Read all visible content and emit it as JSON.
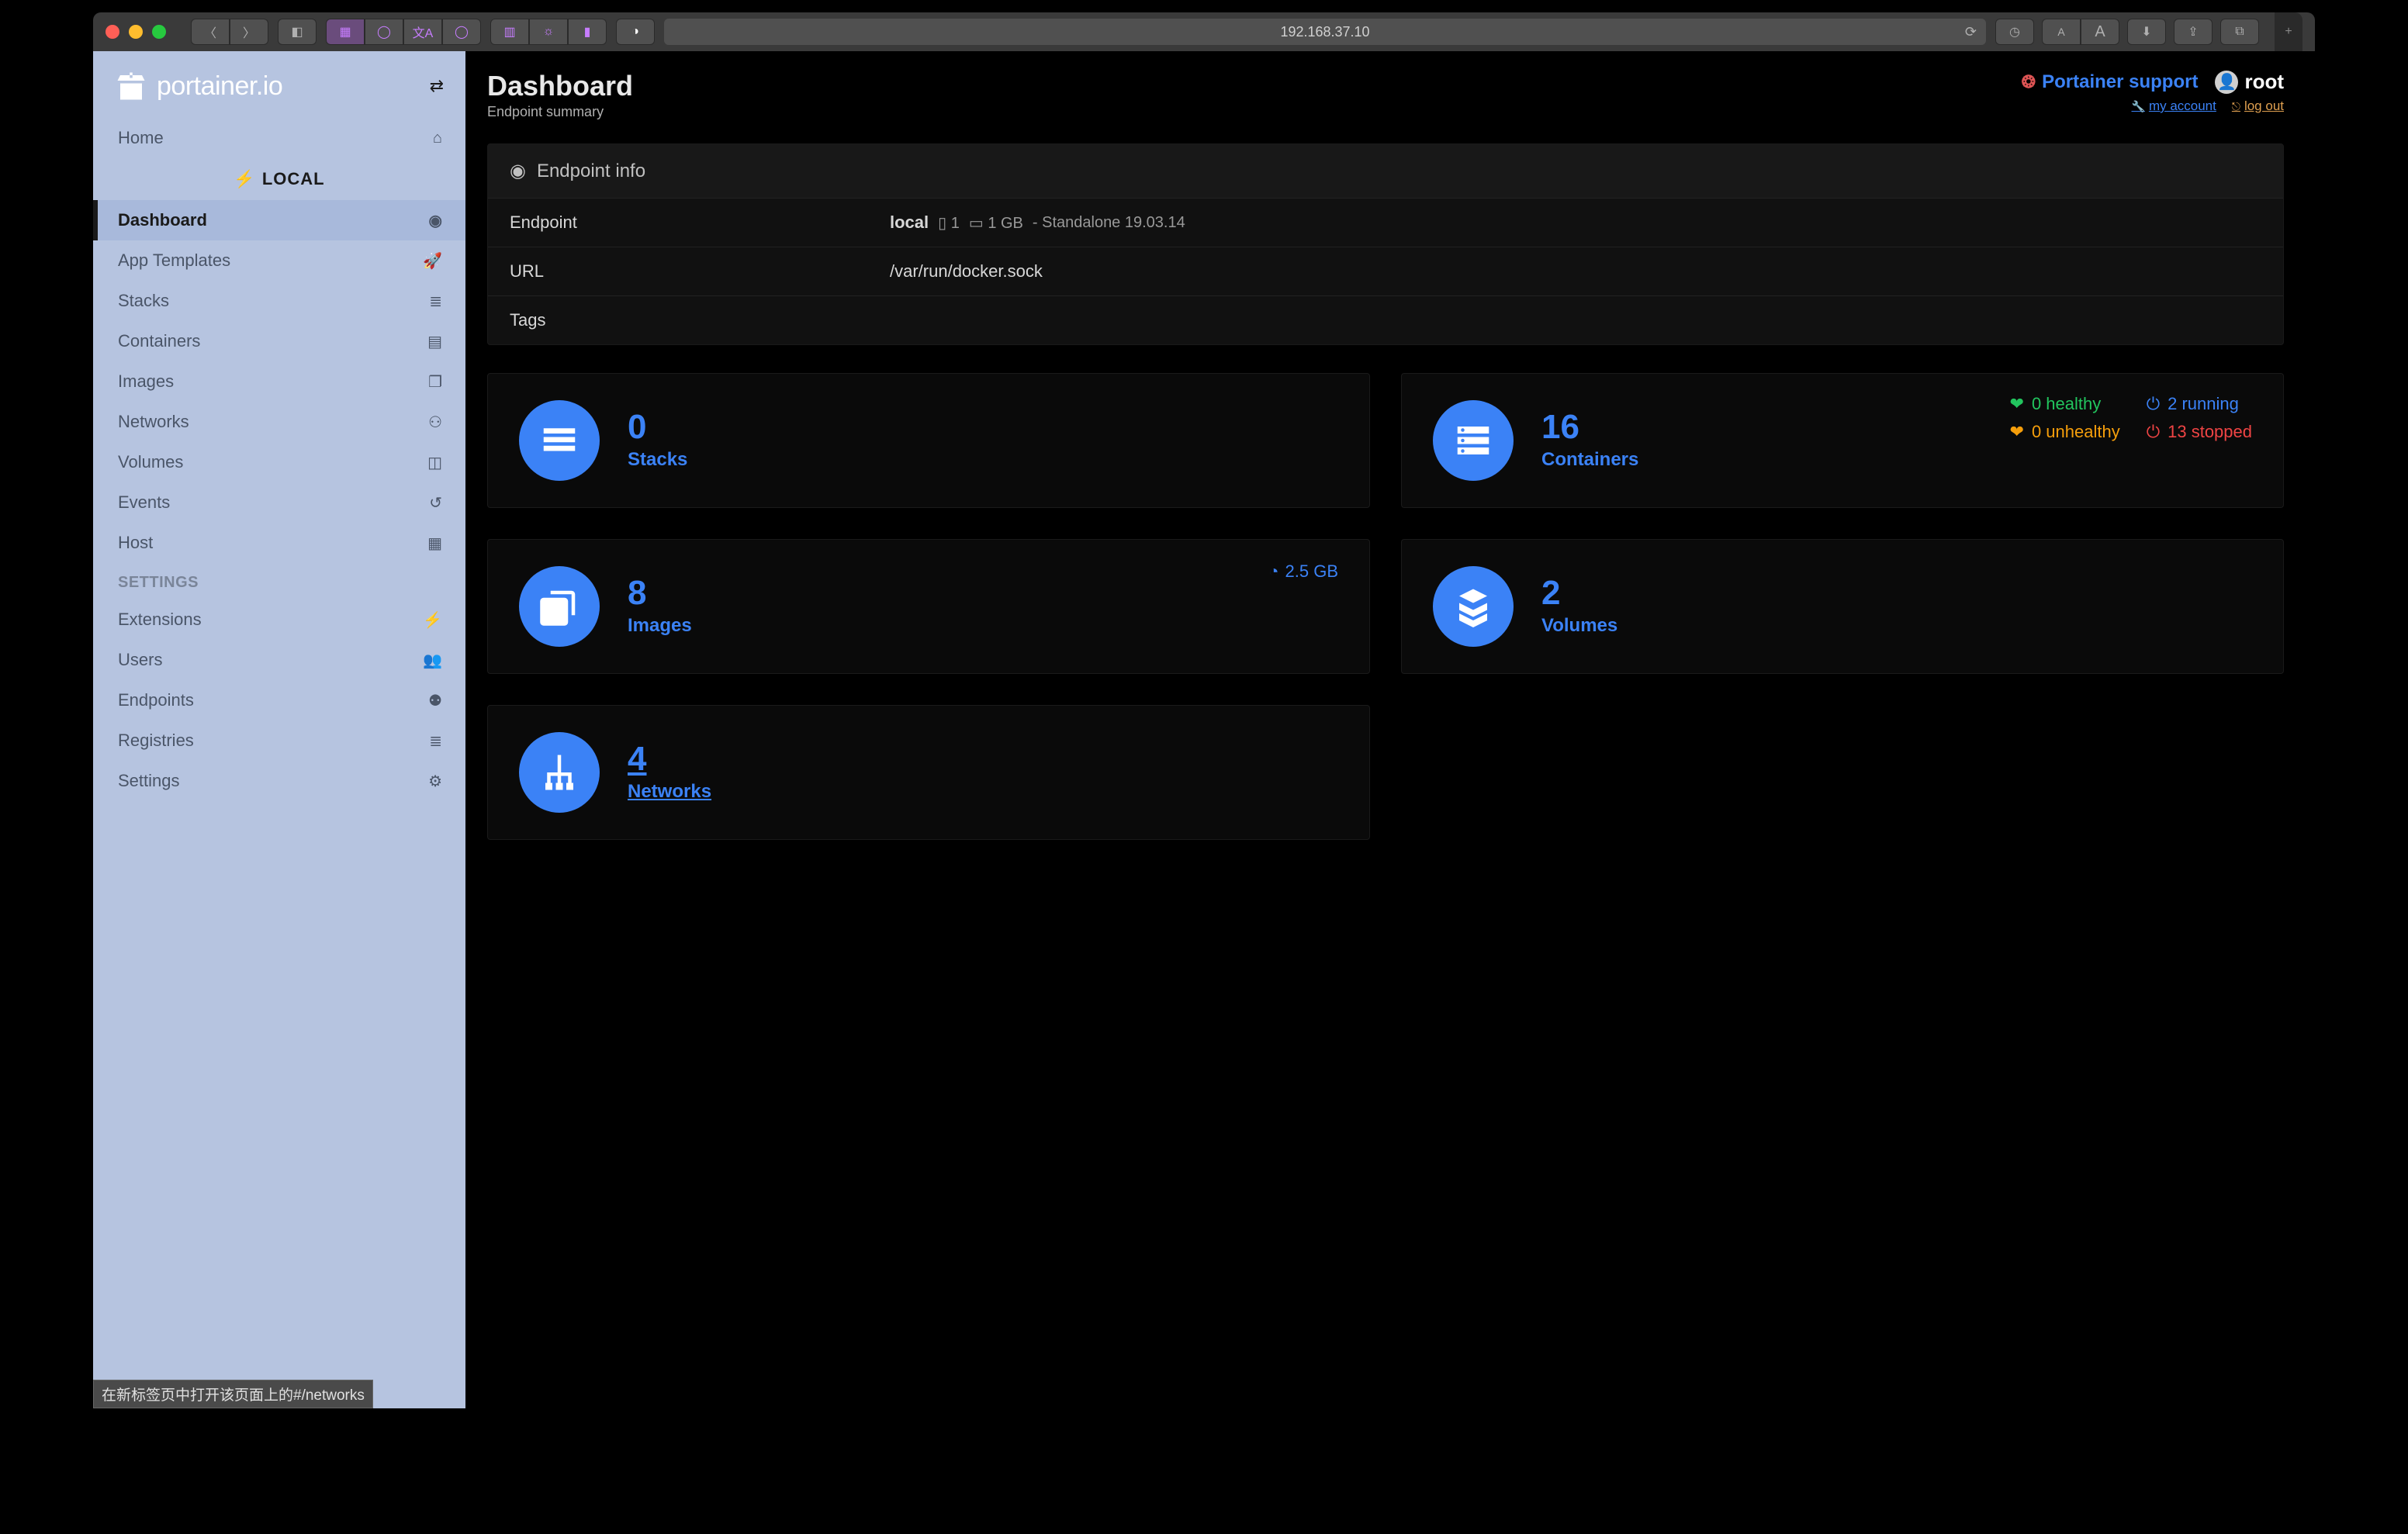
{
  "browser": {
    "address": "192.168.37.10"
  },
  "sidebar": {
    "logo_text": "portainer.io",
    "local_header": "LOCAL",
    "settings_header": "SETTINGS",
    "items_env": [
      {
        "label": "Home",
        "icon": "home"
      }
    ],
    "items_local": [
      {
        "label": "Dashboard",
        "icon": "dashboard",
        "active": true
      },
      {
        "label": "App Templates",
        "icon": "rocket"
      },
      {
        "label": "Stacks",
        "icon": "list"
      },
      {
        "label": "Containers",
        "icon": "containers"
      },
      {
        "label": "Images",
        "icon": "images"
      },
      {
        "label": "Networks",
        "icon": "network"
      },
      {
        "label": "Volumes",
        "icon": "volumes"
      },
      {
        "label": "Events",
        "icon": "history"
      },
      {
        "label": "Host",
        "icon": "grid"
      }
    ],
    "items_settings": [
      {
        "label": "Extensions",
        "icon": "bolt"
      },
      {
        "label": "Users",
        "icon": "users"
      },
      {
        "label": "Endpoints",
        "icon": "plug"
      },
      {
        "label": "Registries",
        "icon": "database"
      },
      {
        "label": "Settings",
        "icon": "cogs"
      }
    ]
  },
  "header": {
    "title": "Dashboard",
    "subtitle": "Endpoint summary",
    "support": "Portainer support",
    "user": "root",
    "my_account": "my account",
    "log_out": "log out"
  },
  "endpoint_panel": {
    "title": "Endpoint info",
    "rows": {
      "endpoint_label": "Endpoint",
      "endpoint_name": "local",
      "cpu": "1",
      "mem": "1 GB",
      "mode": "- Standalone 19.03.14",
      "url_label": "URL",
      "url_value": "/var/run/docker.sock",
      "tags_label": "Tags",
      "tags_value": ""
    }
  },
  "tiles": {
    "stacks": {
      "count": "0",
      "label": "Stacks"
    },
    "containers": {
      "count": "16",
      "label": "Containers",
      "healthy": "0 healthy",
      "running": "2 running",
      "unhealthy": "0 unhealthy",
      "stopped": "13 stopped"
    },
    "images": {
      "count": "8",
      "label": "Images",
      "size": "2.5 GB"
    },
    "volumes": {
      "count": "2",
      "label": "Volumes"
    },
    "networks": {
      "count": "4",
      "label": "Networks"
    }
  },
  "status_tooltip": "在新标签页中打开该页面上的#/networks"
}
